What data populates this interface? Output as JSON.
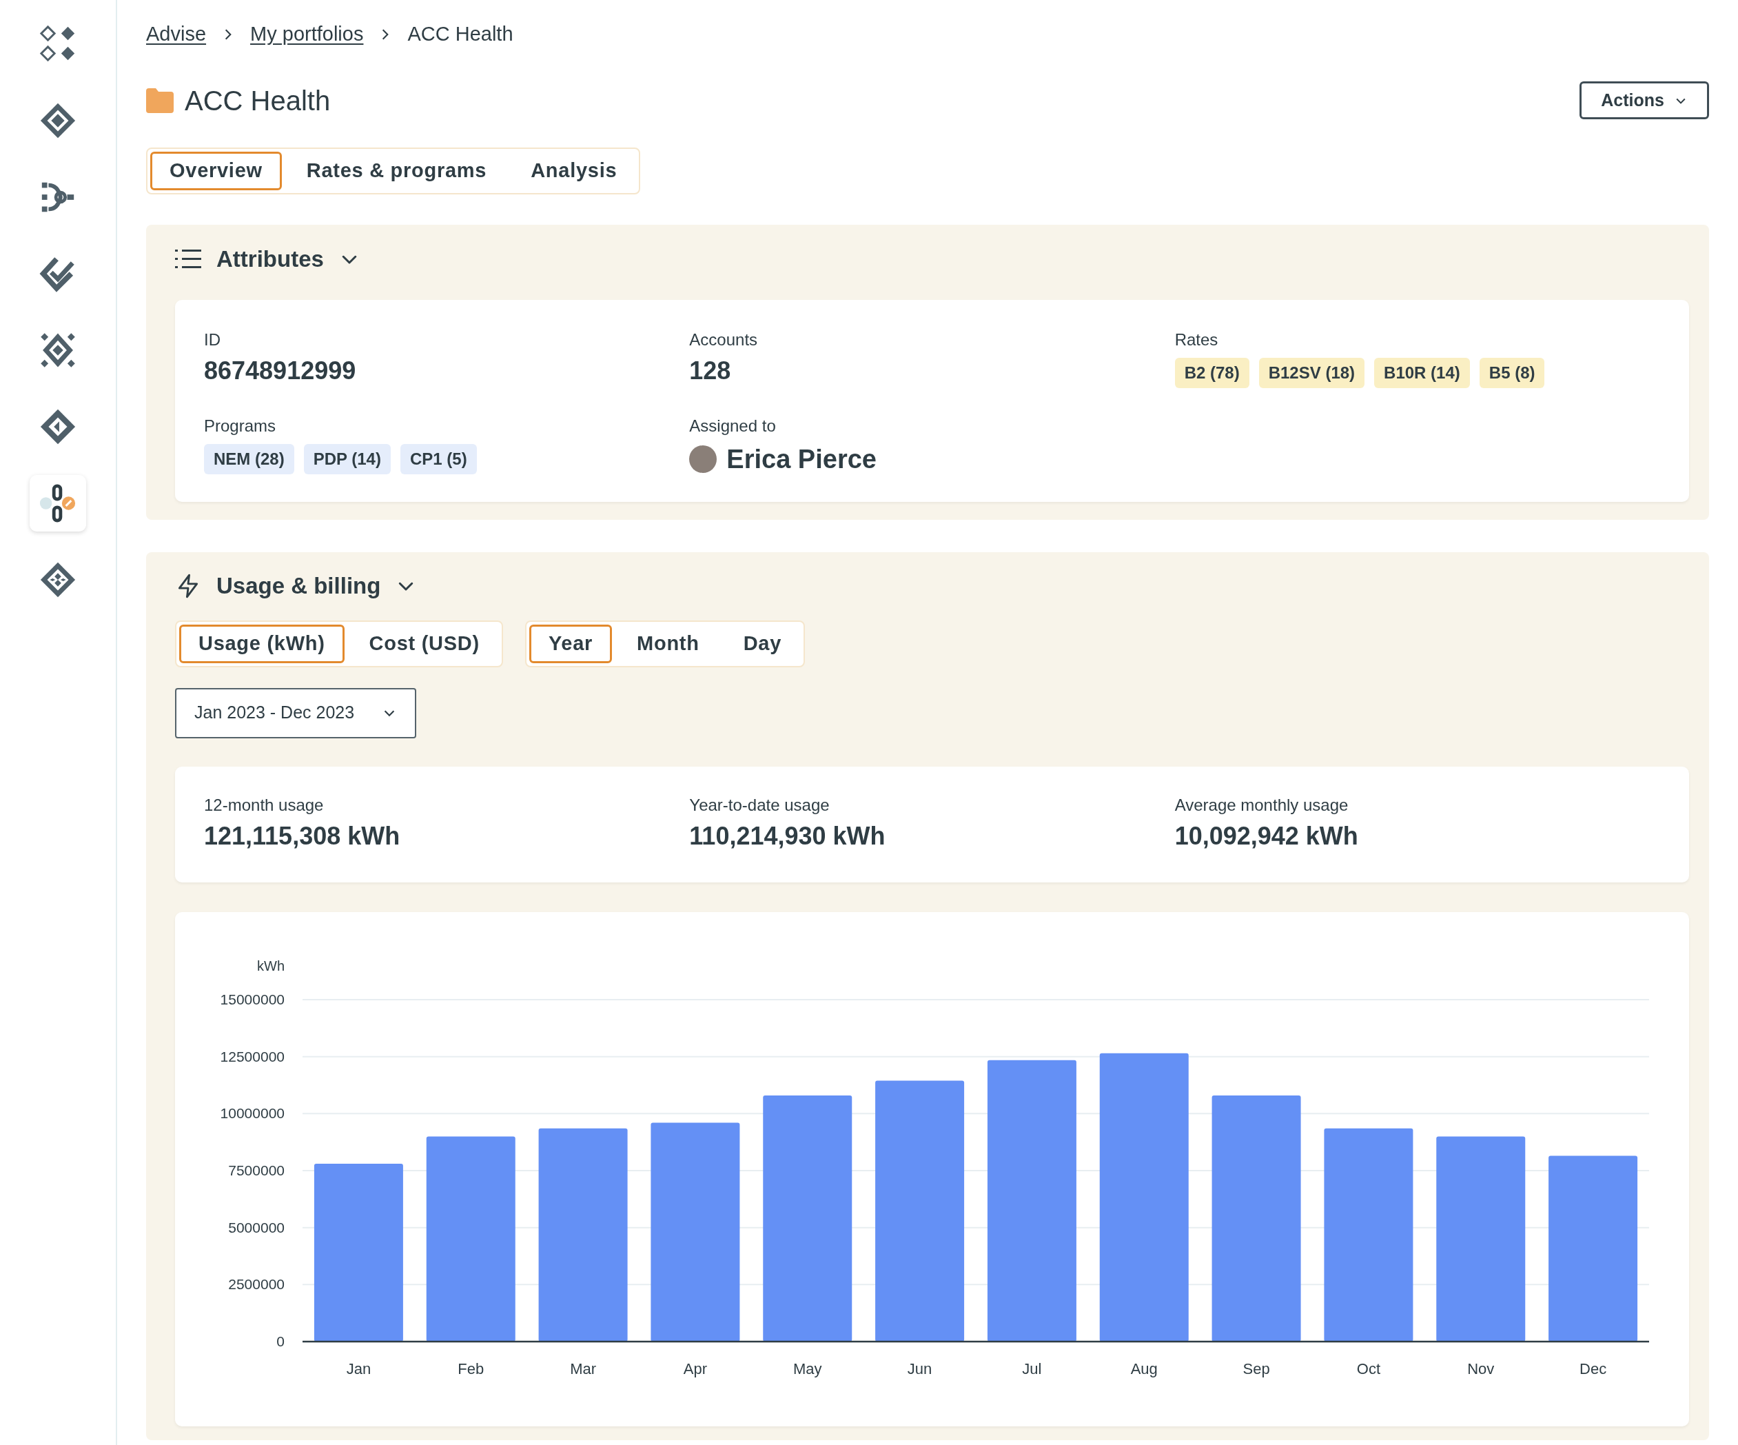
{
  "sidebar": {
    "items": [
      {
        "selected": false
      },
      {
        "selected": false
      },
      {
        "selected": false
      },
      {
        "selected": false
      },
      {
        "selected": false
      },
      {
        "selected": false
      },
      {
        "selected": true
      },
      {
        "selected": false
      }
    ]
  },
  "breadcrumb": [
    {
      "label": "Advise",
      "kind": "link"
    },
    {
      "label": "My portfolios",
      "kind": "link"
    },
    {
      "label": "ACC Health",
      "kind": "current"
    }
  ],
  "header": {
    "title": "ACC Health",
    "actions_button": "Actions"
  },
  "tabs": [
    {
      "label": "Overview",
      "selected": true
    },
    {
      "label": "Rates & programs",
      "selected": false
    },
    {
      "label": "Analysis",
      "selected": false
    }
  ],
  "attributes": {
    "title": "Attributes",
    "expanded": true,
    "id": {
      "label": "ID",
      "value": "86748912999"
    },
    "accounts": {
      "label": "Accounts",
      "value": "128"
    },
    "rates": {
      "label": "Rates",
      "chips": [
        "B2 (78)",
        "B12SV (18)",
        "B10R (14)",
        "B5 (8)"
      ]
    },
    "programs": {
      "label": "Programs",
      "chips": [
        "NEM (28)",
        "PDP (14)",
        "CP1 (5)"
      ]
    },
    "assigned_to": {
      "label": "Assigned to",
      "name": "Erica Pierce"
    }
  },
  "usage_billing": {
    "title": "Usage & billing",
    "expanded": true,
    "metric_tabs": [
      {
        "label": "Usage (kWh)",
        "selected": true
      },
      {
        "label": "Cost (USD)",
        "selected": false
      }
    ],
    "period_tabs": [
      {
        "label": "Year",
        "selected": true
      },
      {
        "label": "Month",
        "selected": false
      },
      {
        "label": "Day",
        "selected": false
      }
    ],
    "date_range": "Jan 2023 - Dec 2023",
    "stats": [
      {
        "label": "12-month usage",
        "value": "121,115,308 kWh"
      },
      {
        "label": "Year-to-date usage",
        "value": "110,214,930 kWh"
      },
      {
        "label": "Average monthly usage",
        "value": "10,092,942 kWh"
      }
    ],
    "chart_data": {
      "type": "bar",
      "ylabel": "kWh",
      "categories": [
        "Jan",
        "Feb",
        "Mar",
        "Apr",
        "May",
        "Jun",
        "Jul",
        "Aug",
        "Sep",
        "Oct",
        "Nov",
        "Dec"
      ],
      "grid": true,
      "series": [
        {
          "color": "#6490f5",
          "values": [
            7800000,
            9000000,
            9350000,
            9600000,
            10800000,
            11450000,
            12350000,
            12650000,
            10800000,
            9350000,
            9000000,
            8150000
          ]
        }
      ],
      "ylim": [
        0,
        15000000
      ],
      "yticks": [
        0,
        2500000,
        5000000,
        7500000,
        10000000,
        12500000,
        15000000
      ]
    }
  }
}
